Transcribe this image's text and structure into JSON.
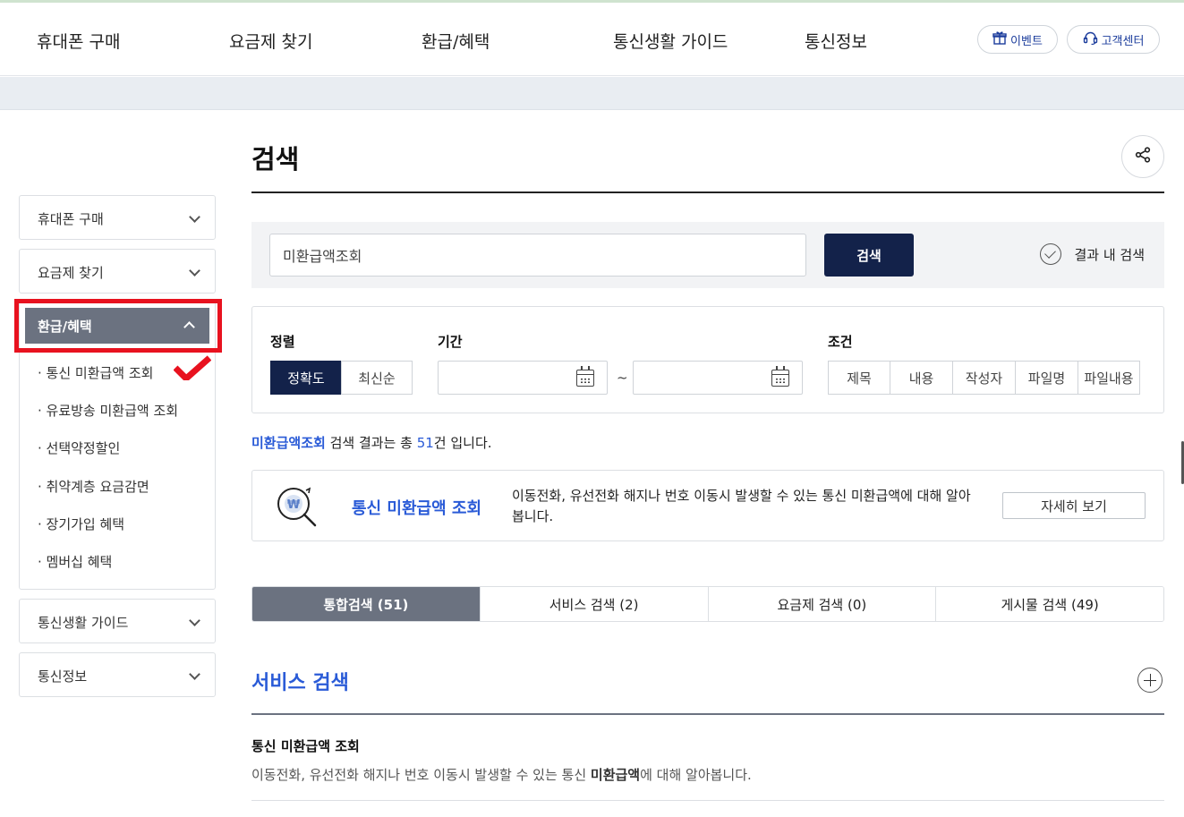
{
  "header": {
    "nav": [
      "휴대폰 구매",
      "요금제 찾기",
      "환급/혜택",
      "통신생활 가이드",
      "통신정보"
    ],
    "event_label": "이벤트",
    "support_label": "고객센터"
  },
  "sidebar": {
    "sections": [
      {
        "label": "휴대폰 구매"
      },
      {
        "label": "요금제 찾기"
      },
      {
        "label": "환급/혜택",
        "expanded": true
      },
      {
        "label": "통신생활 가이드"
      },
      {
        "label": "통신정보"
      }
    ],
    "sub_items": [
      "· 통신 미환급액 조회",
      "· 유료방송 미환급액 조회",
      "· 선택약정할인",
      "· 취약계층 요금감면",
      "· 장기가입 혜택",
      "· 멤버십 혜택"
    ]
  },
  "page": {
    "title": "검색"
  },
  "search": {
    "query": "미환급액조회",
    "button_label": "검색",
    "within_label": "결과 내 검색"
  },
  "filters": {
    "sort_label": "정렬",
    "sort_options": [
      "정확도",
      "최신순"
    ],
    "period_label": "기간",
    "tilde": "~",
    "condition_label": "조건",
    "condition_options": [
      "제목",
      "내용",
      "작성자",
      "파일명",
      "파일내용"
    ]
  },
  "result_summary": {
    "keyword": "미환급액조회",
    "text_before": " 검색 결과는 총 ",
    "count": "51",
    "text_after": "건 입니다."
  },
  "feature_card": {
    "title": "통신 미환급액 조회",
    "description": "이동전화, 유선전화 해지나 번호 이동시 발생할 수 있는 통신 미환급액에 대해 알아봅니다.",
    "button_label": "자세히 보기"
  },
  "tabs": [
    "통합검색 (51)",
    "서비스 검색 (2)",
    "요금제 검색 (0)",
    "게시물 검색 (49)"
  ],
  "service_section": {
    "title": "서비스 검색",
    "item_title": "통신 미환급액 조회",
    "item_desc_before": "이동전화, 유선전화 해지나 번호 이동시 발생할 수 있는 통신 ",
    "item_desc_bold": "미환급액",
    "item_desc_after": "에 대해 알아봅니다."
  },
  "colors": {
    "accent_navy": "#13224a",
    "link_blue": "#2a5bd7",
    "active_gray": "#6b7280",
    "highlight_red": "#e8121f"
  }
}
